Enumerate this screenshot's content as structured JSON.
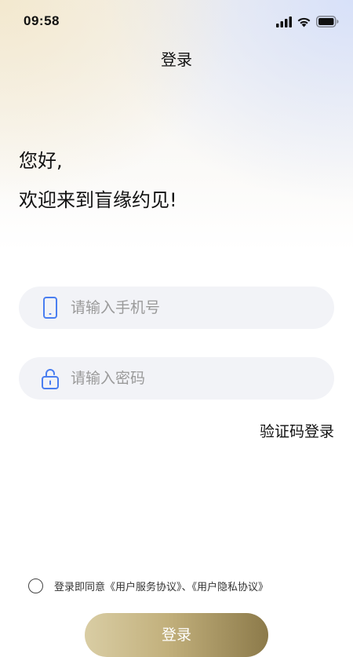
{
  "status_bar": {
    "time": "09:58",
    "icons": [
      "signal-icon",
      "wifi-icon",
      "battery-icon"
    ]
  },
  "nav": {
    "title": "登录"
  },
  "greeting": {
    "line1": "您好,",
    "line2": "欢迎来到盲缘约见!"
  },
  "form": {
    "phone_placeholder": "请输入手机号",
    "phone_value": "",
    "phone_icon": "phone-icon",
    "password_placeholder": "请输入密码",
    "password_value": "",
    "password_icon": "lock-icon",
    "code_login_label": "验证码登录"
  },
  "agreement": {
    "checked": false,
    "prefix": "登录即同意",
    "user_service": "《用户服务协议》",
    "separator": "、",
    "privacy": "《用户隐私协议》"
  },
  "login_button": {
    "label": "登录"
  },
  "colors": {
    "icon_blue": "#4a7ef0",
    "field_bg": "#f2f3f7",
    "button_gold_start": "#d9cda4",
    "button_gold_end": "#8c7a4a"
  }
}
